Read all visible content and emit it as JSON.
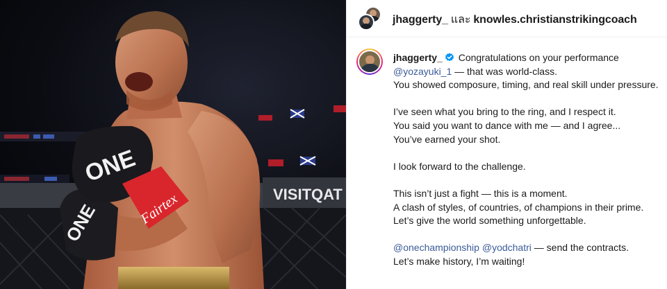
{
  "photo": {
    "banner_text": "VISITQAT",
    "glove_brand": "ONE",
    "wrist_brand": "Fairtex"
  },
  "header": {
    "user_1": "jhaggerty_",
    "conjunction": "และ",
    "user_2": "knowles.christianstrikingcoach"
  },
  "comment": {
    "username": "jhaggerty_",
    "line_1_text": "Congratulations on your performance",
    "line_2_mention": "@yozayuki_1",
    "line_2_text": " — that was world-class.",
    "line_3": "You showed composure, timing, and real skill under pressure.",
    "line_4": "I’ve seen what you bring to the ring, and I respect it.",
    "line_5": "You said you want to dance with me — and I agree...",
    "line_6": "You’ve earned your shot.",
    "line_7": "I look forward to the challenge.",
    "line_8": "This isn’t just a fight — this is a moment.",
    "line_9": "A clash of styles, of countries, of champions in their prime.",
    "line_10": "Let’s give the world something unforgettable.",
    "line_11_mention_1": "@onechampionship",
    "line_11_mention_2": "@yodchatri",
    "line_11_text": " — send the contracts.",
    "line_12": "Let’s make history, I’m waiting!"
  },
  "colors": {
    "mention": "#3b5b9a",
    "verified": "#0095f6",
    "glove_red": "#d9262c"
  },
  "icons": [
    "verified-badge-icon"
  ]
}
